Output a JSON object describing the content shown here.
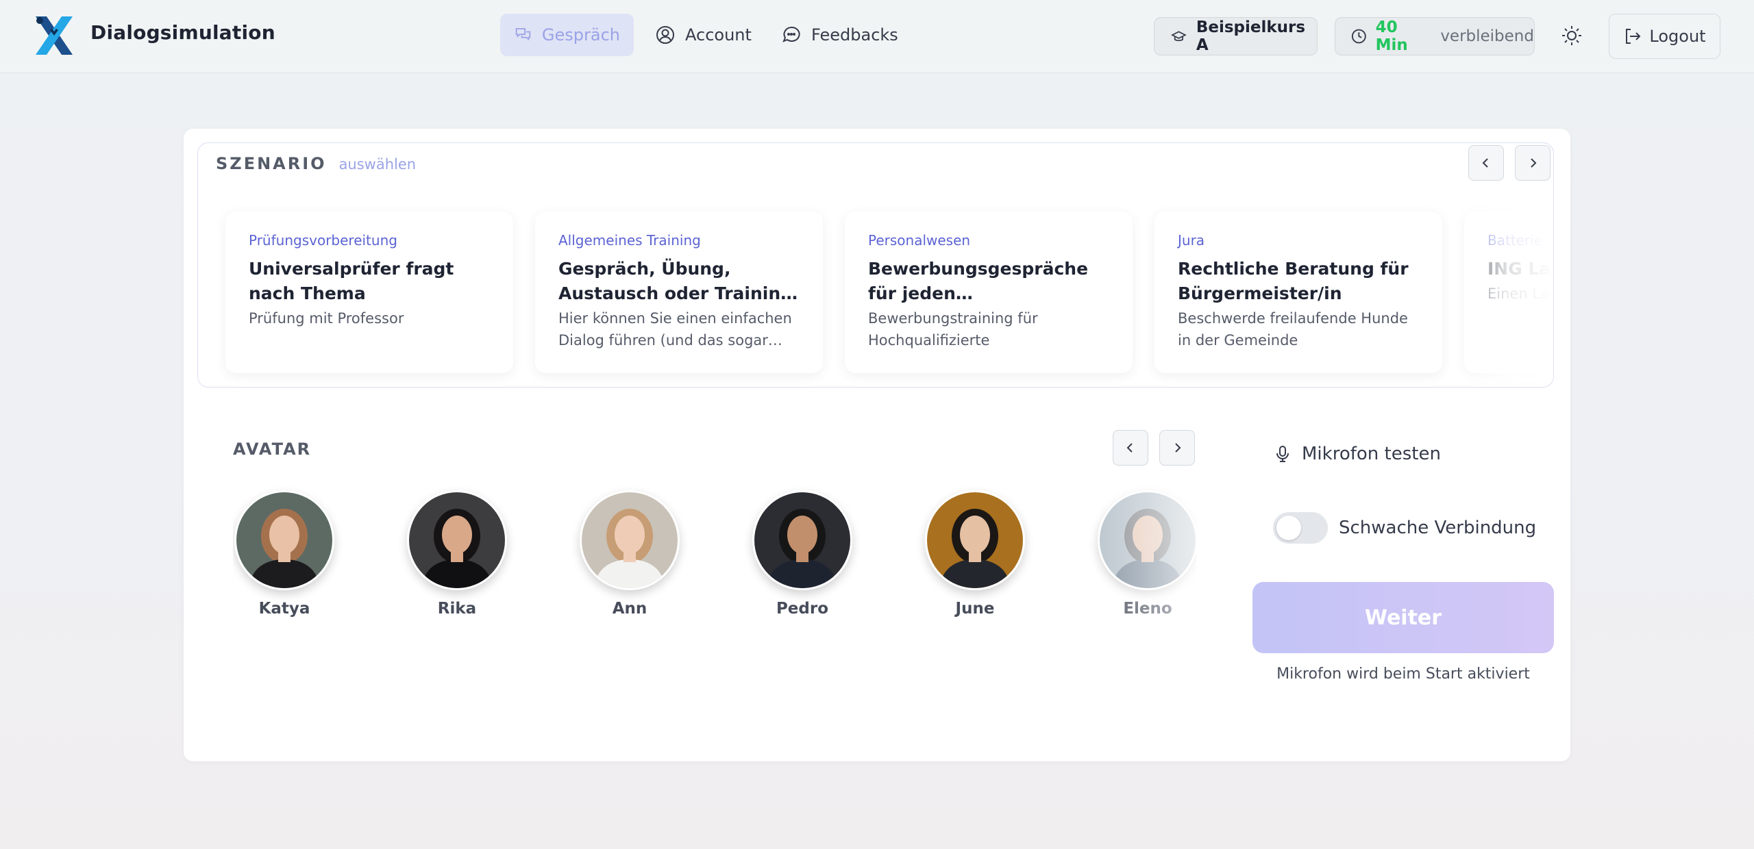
{
  "header": {
    "brand": "Dialogsimulation",
    "nav": [
      {
        "label": "Gespräch",
        "icon": "chat-bubbles-icon",
        "active": true
      },
      {
        "label": "Account",
        "icon": "user-circle-icon",
        "active": false
      },
      {
        "label": "Feedbacks",
        "icon": "message-circle-icon",
        "active": false
      }
    ],
    "course": "Beispielkurs A",
    "timer_value": "40 Min",
    "timer_suffix": "verbleibend",
    "logout": "Logout"
  },
  "scenario": {
    "title": "SZENARIO",
    "subtitle": "auswählen",
    "cards": [
      {
        "category": "Prüfungsvorbereitung",
        "title": "Universalprüfer fragt nach Thema",
        "desc": "Prüfung mit Professor"
      },
      {
        "category": "Allgemeines Training",
        "title": "Gespräch, Übung, Austausch oder Training universal",
        "desc": "Hier können Sie einen einfachen Dialog führen (und das sogar in…"
      },
      {
        "category": "Personalwesen",
        "title": "Bewerbungsgespräche für jeden (akademischen) Beruf",
        "desc": "Bewerbungstraining für Hochqualifizierte"
      },
      {
        "category": "Jura",
        "title": "Rechtliche Beratung für Bürgermeister/in",
        "desc": "Beschwerde freilaufende Hunde in der Gemeinde"
      },
      {
        "category": "Batterie",
        "title": "ING Lab Reflekt",
        "desc": "Einen La dokume"
      }
    ]
  },
  "avatar": {
    "title": "AVATAR",
    "items": [
      {
        "name": "Katya",
        "bg": "#5d6a63",
        "skin": "#e8c1a6",
        "hair": "#a5714d",
        "shirt": "#1c1c1e"
      },
      {
        "name": "Rika",
        "bg": "#3d3d3f",
        "skin": "#d9a888",
        "hair": "#151314",
        "shirt": "#101012"
      },
      {
        "name": "Ann",
        "bg": "#c9c2b8",
        "skin": "#efccb5",
        "hair": "#c69d74",
        "shirt": "#f2f2f0"
      },
      {
        "name": "Pedro",
        "bg": "#2c2d33",
        "skin": "#c28f6c",
        "hair": "#161616",
        "shirt": "#1e2330"
      },
      {
        "name": "June",
        "bg": "#a9701f",
        "skin": "#e5c0a3",
        "hair": "#1b1715",
        "shirt": "#23262c"
      },
      {
        "name": "Eleno",
        "bg": "#b9c4cc",
        "skin": "#e8cdbd",
        "hair": "#8d8f93",
        "shirt": "#8795a3"
      }
    ]
  },
  "panel": {
    "mic_test": "Mikrofon testen",
    "weak_connection": "Schwache Verbindung",
    "weiter": "Weiter",
    "hint": "Mikrofon wird beim Start aktiviert"
  },
  "colors": {
    "accent": "#5b63d3",
    "timer_green": "#22c55e",
    "button": "#c3c4f6"
  }
}
